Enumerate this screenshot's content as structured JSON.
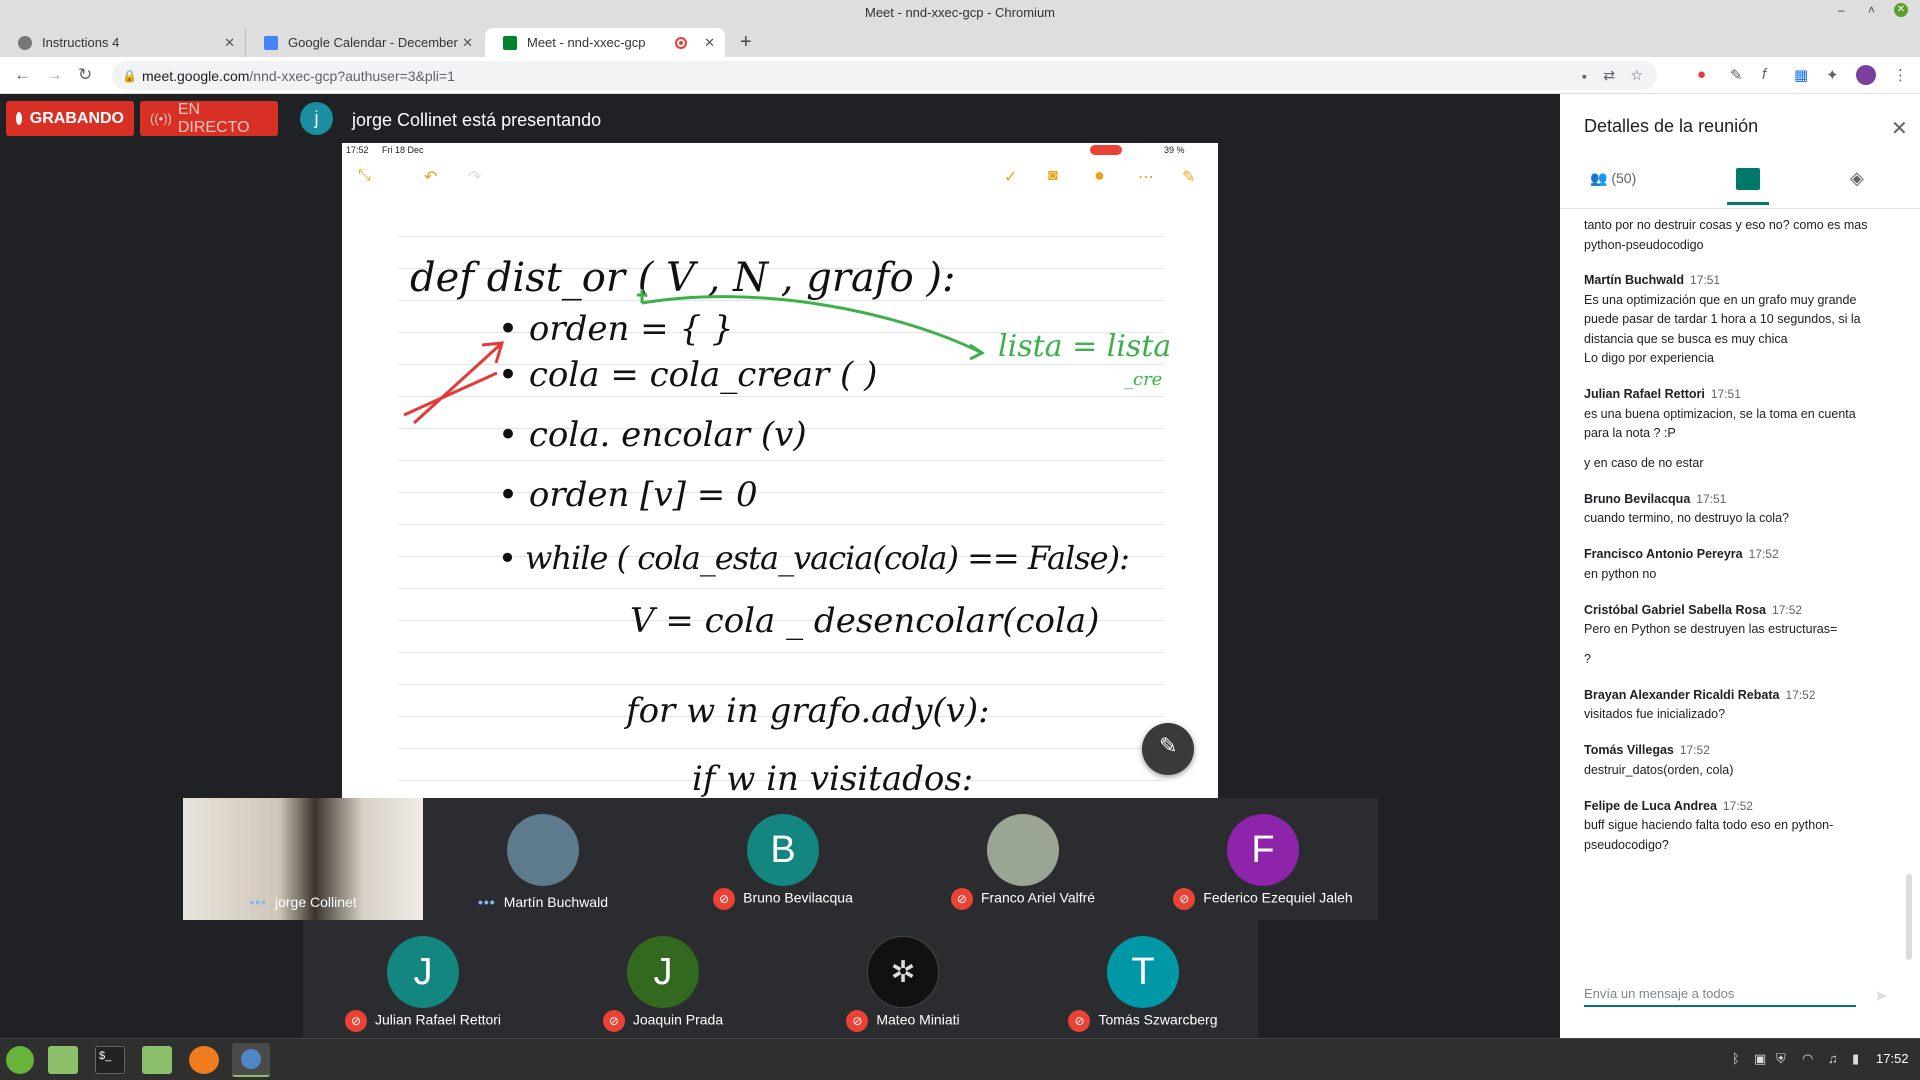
{
  "window": {
    "title": "Meet - nnd-xxec-gcp - Chromium"
  },
  "tabs": [
    {
      "label": "Instructions 4",
      "icon": "globe-icon",
      "active": false
    },
    {
      "label": "Google Calendar - December",
      "icon": "calendar-icon",
      "active": false
    },
    {
      "label": "Meet - nnd-xxec-gcp",
      "icon": "meet-icon",
      "active": true
    }
  ],
  "address": {
    "domain": "meet.google.com",
    "path": "/nnd-xxec-gcp?authuser=3&pli=1"
  },
  "meet": {
    "recording_label": "GRABANDO",
    "live_label": "EN DIRECTO",
    "presenter_initial": "j",
    "presenting_text": "jorge Collinet está presentando"
  },
  "slide": {
    "status_time": "17:52",
    "status_date": "Fri 18 Dec",
    "battery": "39 %",
    "lines": [
      "def   dist_or ( V , N , grafo ):",
      "• orden = { }",
      "• cola = cola_crear ( )",
      "• cola. encolar (v)",
      "• orden [v] = 0",
      "• while ( cola_esta_vacia(cola) == False):",
      "V = cola _ desencolar(cola)",
      "for w in grafo.ady(v):",
      "if w in visitados:"
    ],
    "annotation": "lista = lista",
    "annotation2": "_cre"
  },
  "participants_row1": [
    {
      "name": "jorge Collinet",
      "initial": "",
      "color": "#6b5a4a",
      "muted": false,
      "video": true
    },
    {
      "name": "Martín Buchwald",
      "initial": "",
      "color": "#4a6a7a",
      "muted": false,
      "video": false
    },
    {
      "name": "Bruno Bevilacqua",
      "initial": "B",
      "color": "#12867f",
      "muted": true
    },
    {
      "name": "Franco Ariel Valfré",
      "initial": "",
      "color": "#8a9a8a",
      "muted": true
    },
    {
      "name": "Federico Ezequiel Jaleh",
      "initial": "F",
      "color": "#8e24aa",
      "muted": true
    }
  ],
  "participants_row2": [
    {
      "name": "Julian Rafael Rettori",
      "initial": "J",
      "color": "#12867f",
      "muted": true
    },
    {
      "name": "Joaquin Prada",
      "initial": "J",
      "color": "#33691e",
      "muted": true
    },
    {
      "name": "Mateo Miniati",
      "initial": "",
      "color": "#111111",
      "muted": true
    },
    {
      "name": "Tomás Szwarcberg",
      "initial": "T",
      "color": "#0097a7",
      "muted": true
    }
  ],
  "panel": {
    "title": "Detalles de la reunión",
    "people_count": "(50)",
    "composer_placeholder": "Envía un mensaje a todos",
    "messages": [
      {
        "author": "",
        "time": "",
        "lines": [
          "tanto por no destruir cosas y eso no? como es mas",
          "python-pseudocodigo"
        ]
      },
      {
        "author": "Martín Buchwald",
        "time": "17:51",
        "lines": [
          "Es una optimización que en un grafo muy grande",
          "puede pasar de tardar 1 hora a 10 segundos, si la",
          "distancia que se busca es muy chica",
          "Lo digo por experiencia"
        ]
      },
      {
        "author": "Julian Rafael Rettori",
        "time": "17:51",
        "lines": [
          "es una buena optimizacion, se la toma en cuenta",
          "para la nota ? :P",
          "",
          "y en caso de no estar"
        ]
      },
      {
        "author": "Bruno Bevilacqua",
        "time": "17:51",
        "lines": [
          "cuando termino, no destruyo la cola?"
        ]
      },
      {
        "author": "Francisco Antonio Pereyra",
        "time": "17:52",
        "lines": [
          "en python no"
        ]
      },
      {
        "author": "Cristóbal Gabriel Sabella Rosa",
        "time": "17:52",
        "lines": [
          "Pero en Python se destruyen las estructuras=",
          "",
          "?"
        ]
      },
      {
        "author": "Brayan Alexander Ricaldi Rebata",
        "time": "17:52",
        "lines": [
          "visitados fue inicializado?"
        ]
      },
      {
        "author": "Tomás Villegas",
        "time": "17:52",
        "lines": [
          "destruir_datos(orden, cola)"
        ]
      },
      {
        "author": "Felipe de Luca Andrea",
        "time": "17:52",
        "lines": [
          "buff sigue haciendo falta todo eso en python-",
          "pseudocodigo?"
        ]
      }
    ]
  },
  "taskbar": {
    "clock": "17:52"
  }
}
